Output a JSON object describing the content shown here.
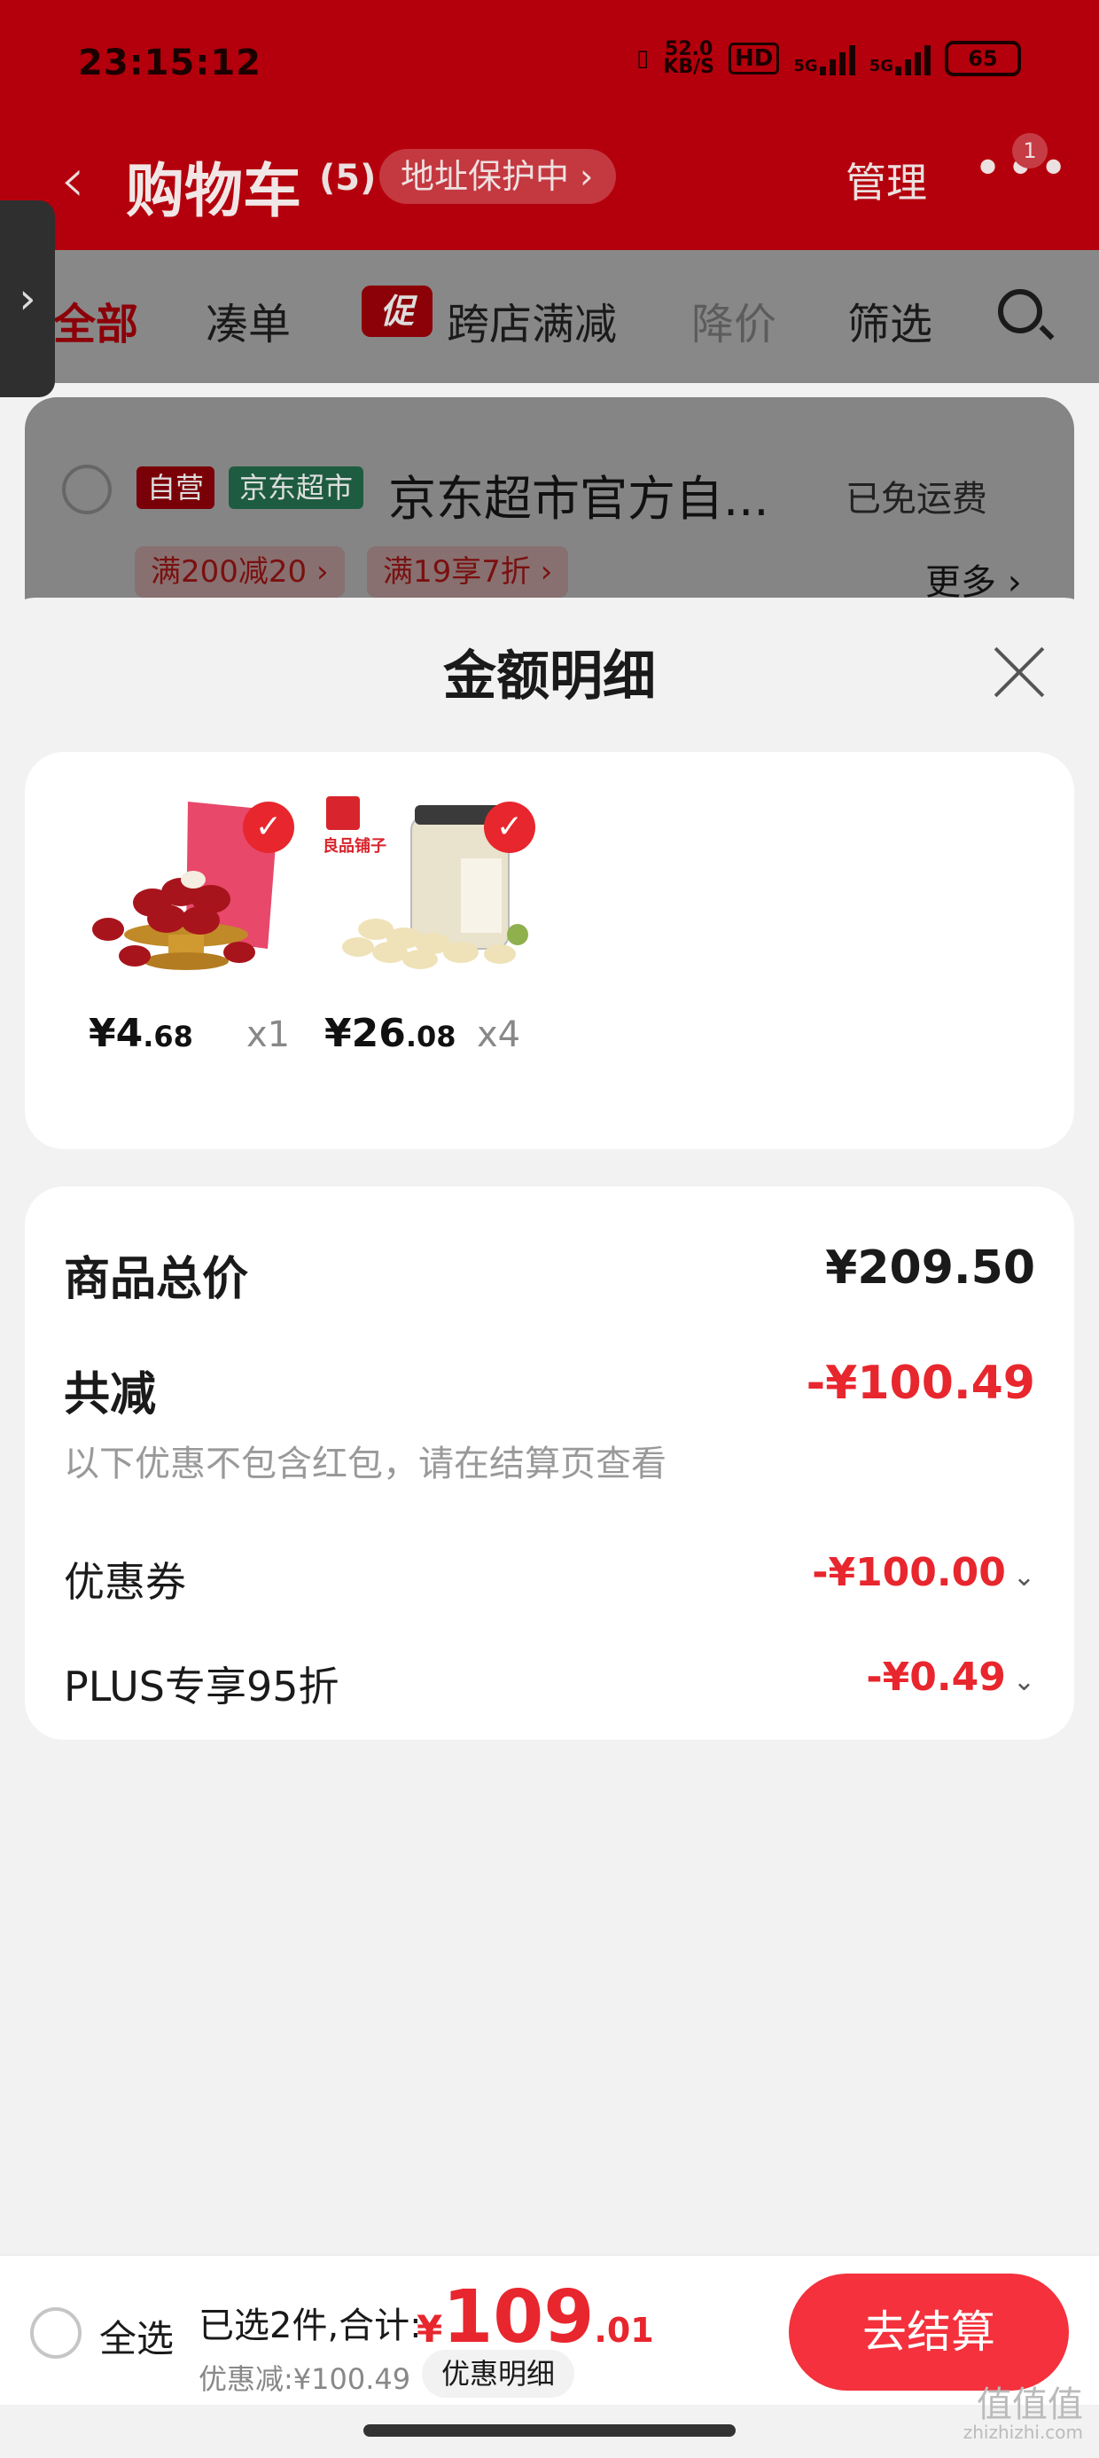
{
  "status": {
    "time": "23:15:12",
    "speed": "52.0",
    "speed_unit": "KB/S",
    "hd": "HD",
    "net1": "5G",
    "net2": "5G",
    "battery": "65"
  },
  "header": {
    "title": "购物车",
    "count": "(5)",
    "protect": "地址保护中 ›",
    "manage": "管理",
    "more_badge": "1"
  },
  "filters": {
    "all": "全部",
    "combine": "凑单",
    "promo_tag": "促",
    "cross": "跨店满减",
    "drop": "降价",
    "filter": "筛选"
  },
  "store": {
    "tag_self": "自营",
    "tag_mart": "京东超市",
    "name": "京东超市官方自...",
    "free_ship": "已免运费",
    "coupons": [
      "满200减20 ›",
      "满19享7折 ›"
    ],
    "more": "更多 ›"
  },
  "sheet": {
    "title": "金额明细",
    "products": [
      {
        "price_int": "¥4",
        "price_dec": ".68",
        "qty": "x1"
      },
      {
        "price_int": "¥26",
        "price_dec": ".08",
        "qty": "x4"
      }
    ],
    "brand_text": "良品铺子",
    "total_label": "商品总价",
    "total_value": "¥209.50",
    "reduce_label": "共减",
    "reduce_value": "-¥100.49",
    "note": "以下优惠不包含红包，请在结算页查看",
    "coupon_label": "优惠券",
    "coupon_value": "-¥100.00",
    "plus_label": "PLUS专享95折",
    "plus_value": "-¥0.49"
  },
  "bottom": {
    "select_all": "全选",
    "selected": "已选2件,合计:",
    "currency": "¥",
    "total_int": "109",
    "total_dec": ".01",
    "discount": "优惠减:¥100.49",
    "detail": "优惠明细",
    "checkout": "去结算"
  },
  "watermark": {
    "main": "值值值",
    "sub": "zhizhizhi.com"
  },
  "colors": {
    "accent": "#e8262d",
    "header_bg": "#b4000c",
    "button": "#f4313c"
  }
}
